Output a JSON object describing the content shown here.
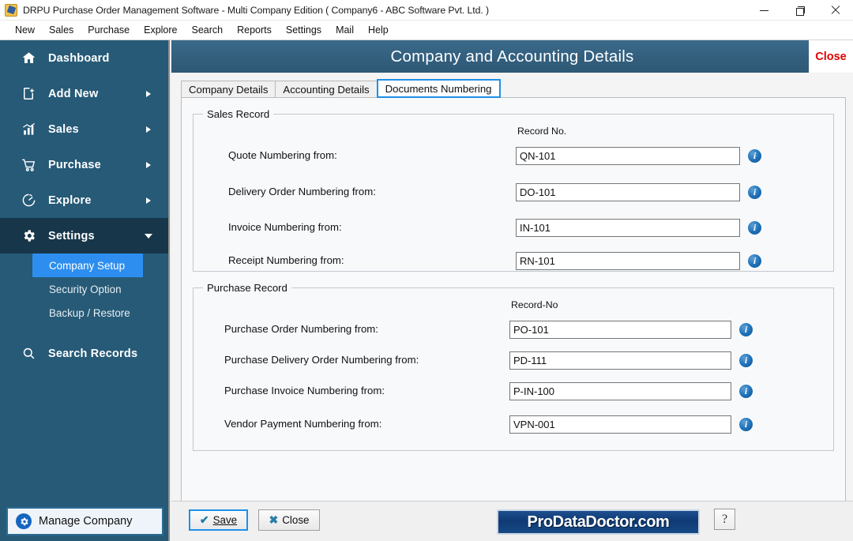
{
  "window": {
    "title": "DRPU Purchase Order Management Software - Multi Company Edition ( Company6 - ABC Software Pvt. Ltd. )",
    "app_icon": "app-icon",
    "controls": {
      "minimize": "minimize-icon",
      "maximize": "maximize-icon",
      "close": "close-icon"
    }
  },
  "menubar": {
    "items": [
      {
        "label": "New"
      },
      {
        "label": "Sales"
      },
      {
        "label": "Purchase"
      },
      {
        "label": "Explore"
      },
      {
        "label": "Search"
      },
      {
        "label": "Reports"
      },
      {
        "label": "Settings"
      },
      {
        "label": "Mail"
      },
      {
        "label": "Help"
      }
    ]
  },
  "sidebar": {
    "background_color": "#265a77",
    "active_color": "#2d8ef0",
    "items": [
      {
        "label": "Dashboard",
        "icon": "home-icon",
        "has_caret": false
      },
      {
        "label": "Add New",
        "icon": "add-document-icon",
        "has_caret": true
      },
      {
        "label": "Sales",
        "icon": "bar-chart-icon",
        "has_caret": true
      },
      {
        "label": "Purchase",
        "icon": "shopping-cart-icon",
        "has_caret": true
      },
      {
        "label": "Explore",
        "icon": "pie-chart-icon",
        "has_caret": true
      },
      {
        "label": "Settings",
        "icon": "gear-icon",
        "has_caret": true,
        "expanded": true
      },
      {
        "label": "Search Records",
        "icon": "search-icon",
        "has_caret": false
      }
    ],
    "settings_submenu": [
      {
        "label": "Company Setup",
        "selected": true
      },
      {
        "label": "Security Option",
        "selected": false
      },
      {
        "label": "Backup / Restore",
        "selected": false
      }
    ],
    "manage_company": {
      "label": "Manage Company",
      "icon": "gear-circle-icon"
    }
  },
  "page": {
    "title": "Company and Accounting Details",
    "close_label": "Close",
    "header_color": "#335f7e"
  },
  "tabs": [
    {
      "label": "Company Details",
      "active": false
    },
    {
      "label": "Accounting Details",
      "active": false
    },
    {
      "label": "Documents Numbering",
      "active": true
    }
  ],
  "sales_record": {
    "group_title": "Sales Record",
    "column_header": "Record No.",
    "fields": [
      {
        "label": "Quote Numbering from:",
        "value": "QN-101",
        "info": "info-icon"
      },
      {
        "label": "Delivery Order Numbering from:",
        "value": "DO-101",
        "info": "info-icon"
      },
      {
        "label": "Invoice Numbering from:",
        "value": "IN-101",
        "info": "info-icon"
      },
      {
        "label": "Receipt Numbering from:",
        "value": "RN-101",
        "info": "info-icon"
      }
    ]
  },
  "purchase_record": {
    "group_title": "Purchase Record",
    "column_header": "Record-No",
    "fields": [
      {
        "label": "Purchase Order Numbering from:",
        "value": "PO-101",
        "info": "info-icon"
      },
      {
        "label": "Purchase Delivery Order Numbering from:",
        "value": "PD-111",
        "info": "info-icon"
      },
      {
        "label": "Purchase Invoice Numbering from:",
        "value": "P-IN-100",
        "info": "info-icon"
      },
      {
        "label": "Vendor Payment Numbering from:",
        "value": "VPN-001",
        "info": "info-icon"
      }
    ]
  },
  "bottombar": {
    "save_label": "Save",
    "close_label": "Close",
    "brand": "ProDataDoctor.com",
    "help_label": "?"
  }
}
